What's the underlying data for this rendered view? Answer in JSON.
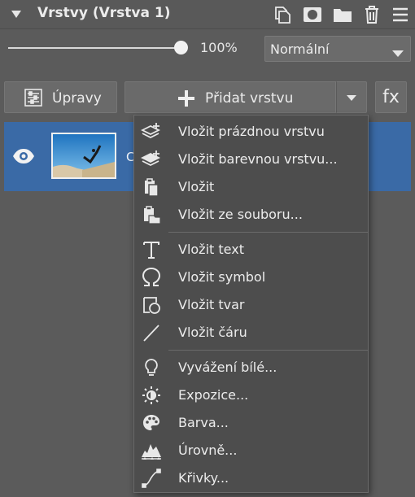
{
  "panel": {
    "title": "Vrstvy (Vrstva 1)",
    "header_icons": [
      "duplicate-layer-icon",
      "mask-icon",
      "folder-icon",
      "trash-icon",
      "menu-icon"
    ]
  },
  "opacity": {
    "value_label": "100%",
    "value": 1.0
  },
  "blend_mode": {
    "selected": "Normální"
  },
  "actions": {
    "adjust_label": "Úpravy",
    "add_layer_label": "Přidat vrstvu",
    "fx_label": "fx"
  },
  "layer": {
    "name_fragment": "C",
    "visible": true
  },
  "menu": {
    "items": [
      {
        "label": "Vložit prázdnou vrstvu",
        "icon": "add-empty-layer-icon"
      },
      {
        "label": "Vložit barevnou vrstvu...",
        "icon": "add-color-layer-icon"
      },
      {
        "label": "Vložit",
        "icon": "paste-icon"
      },
      {
        "label": "Vložit ze souboru...",
        "icon": "paste-from-file-icon"
      },
      {
        "label": "Vložit text",
        "icon": "text-icon"
      },
      {
        "label": "Vložit symbol",
        "icon": "omega-icon"
      },
      {
        "label": "Vložit tvar",
        "icon": "shape-icon"
      },
      {
        "label": "Vložit čáru",
        "icon": "line-icon"
      },
      {
        "label": "Vyvážení bílé...",
        "icon": "bulb-icon"
      },
      {
        "label": "Expozice...",
        "icon": "exposure-icon"
      },
      {
        "label": "Barva...",
        "icon": "palette-icon"
      },
      {
        "label": "Úrovně...",
        "icon": "levels-icon"
      },
      {
        "label": "Křivky...",
        "icon": "curves-icon"
      }
    ]
  },
  "colors": {
    "panel_bg": "#5b5b5b",
    "selected_layer": "#3a6aa6",
    "menu_bg": "#4d4d4d"
  }
}
